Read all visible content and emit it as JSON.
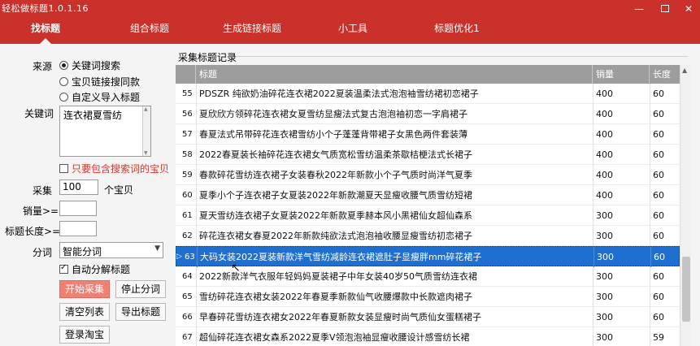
{
  "window": {
    "title": "轻松做标题1.0.1.16",
    "minimize": "—",
    "close": "✕"
  },
  "nav": {
    "tabs": [
      {
        "label": "找标题",
        "active": true
      },
      {
        "label": "组合标题"
      },
      {
        "label": "生成链接标题"
      },
      {
        "label": "小工具"
      },
      {
        "label": "标题优化1"
      }
    ]
  },
  "form": {
    "source_label": "来源",
    "source_options": [
      {
        "label": "关键词搜索",
        "checked": true
      },
      {
        "label": "宝贝链接搜同款",
        "checked": false
      },
      {
        "label": "自定义导入标题",
        "checked": false
      }
    ],
    "keyword_label": "关键词",
    "keyword_value": "连衣裙夏雪纺",
    "must_contain_label": "只要包含搜索词的宝贝",
    "collect_label": "采集",
    "collect_value": "100",
    "collect_unit": "个宝贝",
    "sales_label": "销量>=",
    "sales_value": "",
    "title_len_label": "标题长度>=",
    "title_len_value": "",
    "segment_label": "分词",
    "segment_value": "智能分词",
    "auto_segment_label": "自动分解标题",
    "buttons": {
      "start": "开始采集",
      "stop": "停止分词",
      "clear": "清空列表",
      "export": "导出标题",
      "login": "登录淘宝"
    }
  },
  "records": {
    "group_title": "采集标题记录",
    "columns": {
      "num": "",
      "title": "标题",
      "sales": "销量",
      "length": "长度"
    },
    "selected_index": 8,
    "rows": [
      {
        "num": "55",
        "title": "PDSZR 纯欲奶油碎花连衣裙2022夏装温柔法式泡泡袖雪纺裙初恋裙子",
        "sales": "400",
        "length": "60"
      },
      {
        "num": "56",
        "title": "夏欣欣方领碎花连衣裙女夏雪纺显瘦法式复古泡泡袖初恋一字肩裙子",
        "sales": "400",
        "length": "60"
      },
      {
        "num": "57",
        "title": "春夏法式吊带碎花连衣裙雪纺小个子蓬蓬背带裙子女黑色两件套装薄",
        "sales": "400",
        "length": "60"
      },
      {
        "num": "58",
        "title": "2022春夏装长袖碎花连衣裙女气质宽松雪纺温柔茶歇桔梗法式长裙子",
        "sales": "400",
        "length": "60"
      },
      {
        "num": "59",
        "title": "春款碎花雪纺连衣裙子女装春秋2022年新款小个子气质时尚洋气夏季",
        "sales": "400",
        "length": "60"
      },
      {
        "num": "60",
        "title": "夏季小个子连衣裙子女夏装2022年新款潮夏天显瘦收腰气质雪纺短裙",
        "sales": "400",
        "length": "60"
      },
      {
        "num": "61",
        "title": "夏天雪纺连衣裙子女夏装2022年新款夏季赫本风小黑裙仙女超仙森系",
        "sales": "300",
        "length": "60"
      },
      {
        "num": "62",
        "title": "碎花连衣裙女春夏2022年新款纯欲法式泡泡袖收腰显瘦雪纺初恋裙子",
        "sales": "300",
        "length": "60"
      },
      {
        "num": "63",
        "title": "大码女装2022夏装新款洋气雪纺减龄连衣裙遮肚子显瘦胖mm碎花裙子",
        "sales": "300",
        "length": "60"
      },
      {
        "num": "64",
        "title": "2022新款洋气衣服年轻妈妈夏装裙子中年女装40岁50气质雪纺连衣裙",
        "sales": "300",
        "length": "60"
      },
      {
        "num": "65",
        "title": "雪纺碎花连衣裙女装2022年春夏季新款仙气收腰爆款中长款遮肉裙子",
        "sales": "300",
        "length": "60"
      },
      {
        "num": "66",
        "title": "早春碎花雪纺连衣裙女2022年春夏新款女装显瘦时尚气质仙女蛋糕裙子",
        "sales": "300",
        "length": "60"
      },
      {
        "num": "67",
        "title": "超仙碎花连衣裙女森系2022夏季V领泡泡袖显瘦收腰设计感雪纺长裙",
        "sales": "300",
        "length": "59"
      }
    ]
  },
  "icons": {
    "selected_row": "triangle-right",
    "scroll_up": "triangle-up",
    "dropdown": "triangle-down"
  },
  "colors": {
    "brand": "#c9312a",
    "primary_button": "#f07f74",
    "selection": "#1f6fd1",
    "warning_text": "#d9342b"
  }
}
